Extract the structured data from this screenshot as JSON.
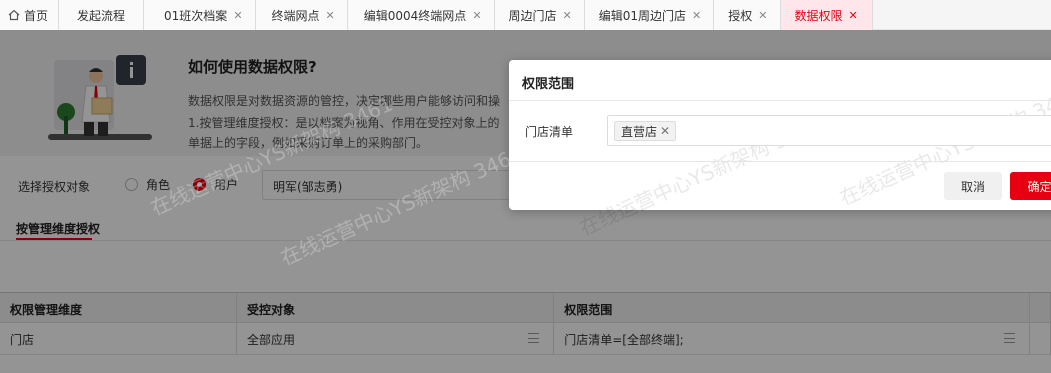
{
  "tabs": [
    {
      "label": "首页",
      "closable": false,
      "active": false
    },
    {
      "label": "发起流程",
      "closable": false,
      "active": false
    },
    {
      "label": "01班次档案",
      "closable": true,
      "active": false
    },
    {
      "label": "终端网点",
      "closable": true,
      "active": false
    },
    {
      "label": "编辑0004终端网点",
      "closable": true,
      "active": false
    },
    {
      "label": "周边门店",
      "closable": true,
      "active": false
    },
    {
      "label": "编辑01周边门店",
      "closable": true,
      "active": false
    },
    {
      "label": "授权",
      "closable": true,
      "active": false
    },
    {
      "label": "数据权限",
      "closable": true,
      "active": true
    }
  ],
  "help": {
    "title": "如何使用数据权限?",
    "line1": "数据权限是对数据资源的管控，决定哪些用户能够访问和操",
    "line2": "1.按管理维度授权：是以档案为视角、作用在受控对象上的",
    "line3": "单据上的字段，例如采购订单上的采购部门。"
  },
  "selector": {
    "label": "选择授权对象",
    "option_role": "角色",
    "option_user": "用户",
    "selected": "用户",
    "user_value": "明军(邹志勇)"
  },
  "subtab": "按管理维度授权",
  "table": {
    "headers": [
      "权限管理维度",
      "受控对象",
      "权限范围"
    ],
    "rows": [
      [
        "门店",
        "全部应用",
        "门店清单=[全部终端];"
      ]
    ]
  },
  "watermark": "在线运营中心YS新架构 3461",
  "dialog": {
    "title": "权限范围",
    "field_label": "门店清单",
    "chips": [
      "直营店"
    ],
    "cancel": "取消",
    "confirm": "确定"
  },
  "colors": {
    "accent": "#e60012",
    "active_tab_bg": "#ffe6ea"
  }
}
